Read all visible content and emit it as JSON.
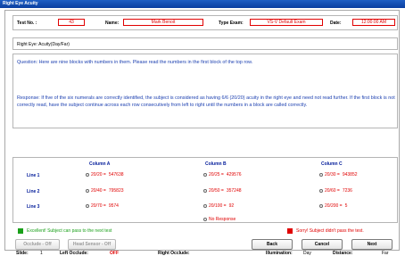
{
  "window": {
    "title": "Right Eye Acuity"
  },
  "header": {
    "test_no_label": "Test No. :",
    "test_no_value": "43",
    "name_label": "Name:",
    "name_value": "Mark Benoit",
    "type_exam_label": "Type Exam:",
    "type_exam_value": "VS-V Default Exam",
    "date_label": "Date:",
    "date_value": "12:00:00 AM"
  },
  "section_title": "Right Eye: Acuity(Day/Far)",
  "question": "Question:  Here are nine blocks with numbers in them.  Please read the numbers in the first block of the top row.",
  "response": "Response:  If five of the six numerals are correctly identified, the subject is considered as having 6/6 (20/20) acuity in the right eye and need not read further.  If the first block is not correctly read, have the subject continue across each row consecutively from left to right until the numbers in a block are called correctly.",
  "grid": {
    "col_a": "Column A",
    "col_b": "Column B",
    "col_c": "Column C",
    "lines": [
      {
        "label": "Line 1",
        "a": "20/20 =",
        "a_val": "547638",
        "b": "20/25 =",
        "b_val": "429576",
        "c": "20/30 =",
        "c_val": "943852"
      },
      {
        "label": "Line 2",
        "a": "20/40 =",
        "a_val": "795823",
        "b": "20/50 =",
        "b_val": "357248",
        "c": "20/60 =",
        "c_val": "7236"
      },
      {
        "label": "Line 3",
        "a": "20/70 =",
        "a_val": "9574",
        "b": "20/100 =",
        "b_val": "92",
        "c": "20/200 =",
        "c_val": "5"
      }
    ],
    "no_response": "No Response"
  },
  "feedback": {
    "pass_text": "Excellent! Subject can pass to the next test",
    "fail_text": "Sorry! Subject didn't pass the test.",
    "pass_color": "#1aa01a",
    "fail_color": "#e00000"
  },
  "buttons": {
    "occlude": "Occlude - Off",
    "head_sensor": "Head Sensor - Off",
    "back": "Back",
    "cancel": "Cancel",
    "next": "Next"
  },
  "status": {
    "slide_label": "Slide:",
    "slide_value": "1",
    "left_occlude_label": "Left Occlude:",
    "left_occlude_value": "OFF",
    "right_occlude_label": "Right Occlude:",
    "illumination_label": "Illumination:",
    "illumination_value": "Day",
    "distance_label": "Distance:",
    "distance_value": "Far"
  }
}
